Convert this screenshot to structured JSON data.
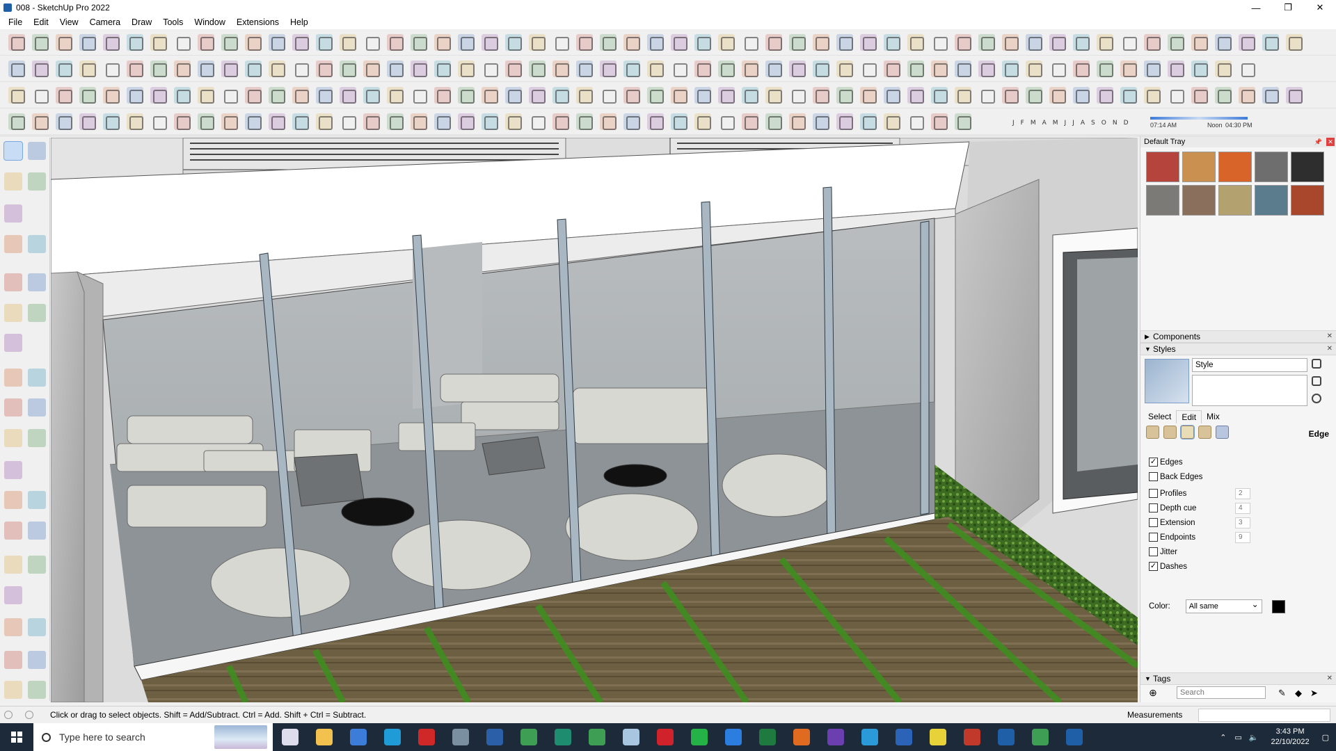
{
  "window": {
    "title": "008 - SketchUp Pro 2022",
    "minimize": "—",
    "maximize": "❐",
    "close": "✕"
  },
  "menu": [
    "File",
    "Edit",
    "View",
    "Camera",
    "Draw",
    "Tools",
    "Window",
    "Extensions",
    "Help"
  ],
  "shadow": {
    "months": [
      "J",
      "F",
      "M",
      "A",
      "M",
      "J",
      "J",
      "A",
      "S",
      "O",
      "N",
      "D"
    ],
    "time_start": "07:14 AM",
    "time_mid": "Noon",
    "time_end": "04:30 PM"
  },
  "tray": {
    "title": "Default Tray",
    "materials": [
      "#b5453c",
      "#c9904f",
      "#d9642a",
      "#6e6e6e",
      "#2e2e2e",
      "#7c7a76",
      "#8a6f5c",
      "#b3a170",
      "#5b7c8c",
      "#a8472c"
    ],
    "components_label": "Components",
    "styles_label": "Styles",
    "style_name": "Style",
    "tabs": [
      "Select",
      "Edit",
      "Mix"
    ],
    "edit_section": "Edge",
    "checks": [
      {
        "label": "Edges",
        "checked": true,
        "value": ""
      },
      {
        "label": "Back Edges",
        "checked": false,
        "value": ""
      },
      {
        "label": "Profiles",
        "checked": false,
        "value": "2"
      },
      {
        "label": "Depth cue",
        "checked": false,
        "value": "4"
      },
      {
        "label": "Extension",
        "checked": false,
        "value": "3"
      },
      {
        "label": "Endpoints",
        "checked": false,
        "value": "9"
      },
      {
        "label": "Jitter",
        "checked": false,
        "value": ""
      },
      {
        "label": "Dashes",
        "checked": true,
        "value": ""
      }
    ],
    "color_label": "Color:",
    "color_value": "All same",
    "tags_label": "Tags",
    "tags_search_placeholder": "Search"
  },
  "status": {
    "hint": "Click or drag to select objects. Shift = Add/Subtract. Ctrl = Add. Shift + Ctrl = Subtract.",
    "measurements_label": "Measurements"
  },
  "taskbar": {
    "search_placeholder": "Type here to search",
    "time": "3:43 PM",
    "date": "22/10/2022"
  },
  "colors": {
    "accent": "#1f5fa8",
    "taskbar": "#1c2a3a",
    "lawn": "#3c6b22",
    "deck": "#6d5f42"
  }
}
